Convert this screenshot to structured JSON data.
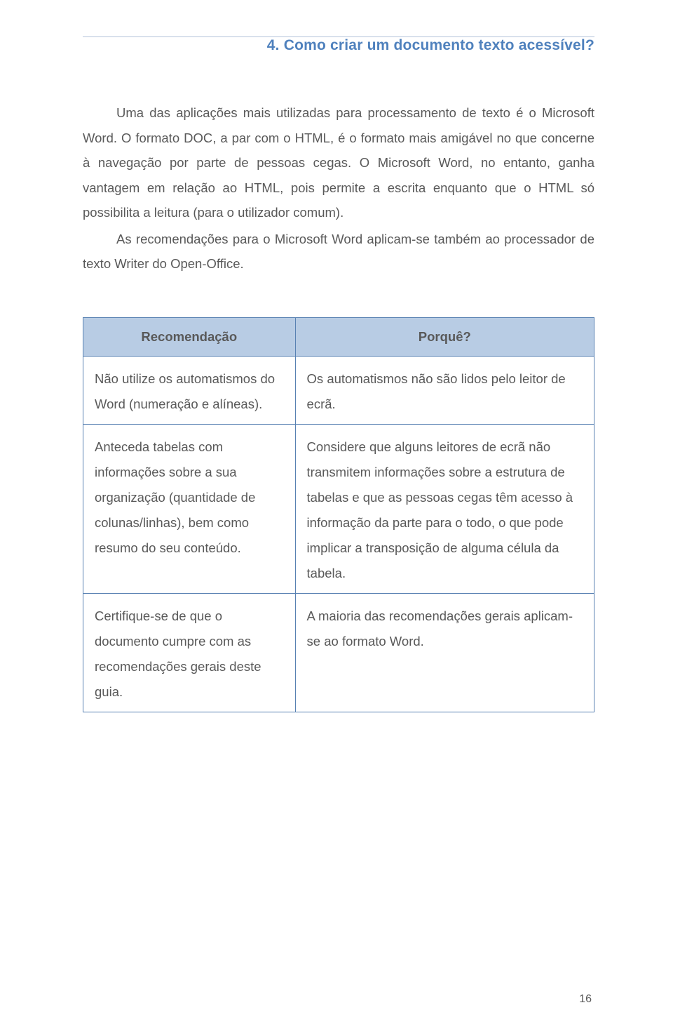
{
  "header": {
    "title": "4. Como criar um documento texto acessível?"
  },
  "paragraphs": {
    "p1": "Uma das aplicações mais utilizadas para processamento de texto é o Microsoft Word. O formato DOC, a par com o HTML, é o formato mais amigável no que concerne à navegação por parte de pessoas cegas. O Microsoft Word, no entanto, ganha vantagem em relação ao HTML, pois permite a escrita enquanto que o  HTML só possibilita a leitura (para o utilizador comum).",
    "p2": "As recomendações para o Microsoft Word aplicam-se também ao processador de texto Writer do Open-Office."
  },
  "table": {
    "headers": {
      "col1": "Recomendação",
      "col2": "Porquê?"
    },
    "rows": [
      {
        "c1": "Não utilize os automatismos do Word (numeração e alíneas).",
        "c2": "Os automatismos não são lidos pelo leitor de ecrã."
      },
      {
        "c1": "Anteceda tabelas com informações sobre a sua organização (quantidade de colunas/linhas), bem como resumo do seu conteúdo.",
        "c2": "Considere que alguns leitores de ecrã não transmitem informações sobre a estrutura de tabelas e que as pessoas cegas têm acesso à informação da parte para o todo, o que pode implicar a transposição de alguma célula da tabela."
      },
      {
        "c1": "Certifique-se de que o documento cumpre com as recomendações gerais deste guia.",
        "c2": "A maioria das recomendações gerais aplicam-se ao formato Word."
      }
    ]
  },
  "page_number": "16"
}
